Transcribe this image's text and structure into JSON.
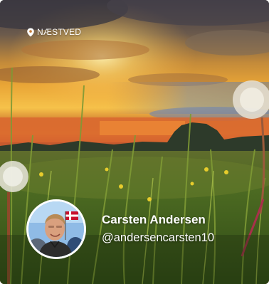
{
  "cover": {
    "location_icon": "map-pin-icon",
    "location": "NÆSTVED"
  },
  "profile": {
    "name": "Carsten Andersen",
    "handle": "@andersencarsten10"
  }
}
